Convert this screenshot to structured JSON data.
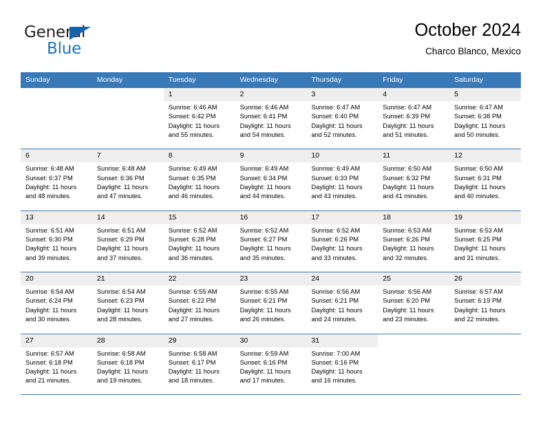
{
  "brand": {
    "name_part1": "General",
    "name_part2": "Blue",
    "accent_color": "#1b75bb",
    "triangle_color": "#1464ad"
  },
  "header": {
    "title": "October 2024",
    "subtitle": "Charco Blanco, Mexico"
  },
  "calendar": {
    "header_bg": "#3a79b8",
    "daynum_band_bg": "#eeeeee",
    "weekdays": [
      "Sunday",
      "Monday",
      "Tuesday",
      "Wednesday",
      "Thursday",
      "Friday",
      "Saturday"
    ],
    "weeks": [
      [
        {
          "day": "",
          "sunrise": "",
          "sunset": "",
          "daylight1": "",
          "daylight2": "",
          "blank": true
        },
        {
          "day": "",
          "sunrise": "",
          "sunset": "",
          "daylight1": "",
          "daylight2": "",
          "blank": true
        },
        {
          "day": "1",
          "sunrise": "Sunrise: 6:46 AM",
          "sunset": "Sunset: 6:42 PM",
          "daylight1": "Daylight: 11 hours",
          "daylight2": "and 55 minutes."
        },
        {
          "day": "2",
          "sunrise": "Sunrise: 6:46 AM",
          "sunset": "Sunset: 6:41 PM",
          "daylight1": "Daylight: 11 hours",
          "daylight2": "and 54 minutes."
        },
        {
          "day": "3",
          "sunrise": "Sunrise: 6:47 AM",
          "sunset": "Sunset: 6:40 PM",
          "daylight1": "Daylight: 11 hours",
          "daylight2": "and 52 minutes."
        },
        {
          "day": "4",
          "sunrise": "Sunrise: 6:47 AM",
          "sunset": "Sunset: 6:39 PM",
          "daylight1": "Daylight: 11 hours",
          "daylight2": "and 51 minutes."
        },
        {
          "day": "5",
          "sunrise": "Sunrise: 6:47 AM",
          "sunset": "Sunset: 6:38 PM",
          "daylight1": "Daylight: 11 hours",
          "daylight2": "and 50 minutes."
        }
      ],
      [
        {
          "day": "6",
          "sunrise": "Sunrise: 6:48 AM",
          "sunset": "Sunset: 6:37 PM",
          "daylight1": "Daylight: 11 hours",
          "daylight2": "and 48 minutes."
        },
        {
          "day": "7",
          "sunrise": "Sunrise: 6:48 AM",
          "sunset": "Sunset: 6:36 PM",
          "daylight1": "Daylight: 11 hours",
          "daylight2": "and 47 minutes."
        },
        {
          "day": "8",
          "sunrise": "Sunrise: 6:49 AM",
          "sunset": "Sunset: 6:35 PM",
          "daylight1": "Daylight: 11 hours",
          "daylight2": "and 46 minutes."
        },
        {
          "day": "9",
          "sunrise": "Sunrise: 6:49 AM",
          "sunset": "Sunset: 6:34 PM",
          "daylight1": "Daylight: 11 hours",
          "daylight2": "and 44 minutes."
        },
        {
          "day": "10",
          "sunrise": "Sunrise: 6:49 AM",
          "sunset": "Sunset: 6:33 PM",
          "daylight1": "Daylight: 11 hours",
          "daylight2": "and 43 minutes."
        },
        {
          "day": "11",
          "sunrise": "Sunrise: 6:50 AM",
          "sunset": "Sunset: 6:32 PM",
          "daylight1": "Daylight: 11 hours",
          "daylight2": "and 41 minutes."
        },
        {
          "day": "12",
          "sunrise": "Sunrise: 6:50 AM",
          "sunset": "Sunset: 6:31 PM",
          "daylight1": "Daylight: 11 hours",
          "daylight2": "and 40 minutes."
        }
      ],
      [
        {
          "day": "13",
          "sunrise": "Sunrise: 6:51 AM",
          "sunset": "Sunset: 6:30 PM",
          "daylight1": "Daylight: 11 hours",
          "daylight2": "and 39 minutes."
        },
        {
          "day": "14",
          "sunrise": "Sunrise: 6:51 AM",
          "sunset": "Sunset: 6:29 PM",
          "daylight1": "Daylight: 11 hours",
          "daylight2": "and 37 minutes."
        },
        {
          "day": "15",
          "sunrise": "Sunrise: 6:52 AM",
          "sunset": "Sunset: 6:28 PM",
          "daylight1": "Daylight: 11 hours",
          "daylight2": "and 36 minutes."
        },
        {
          "day": "16",
          "sunrise": "Sunrise: 6:52 AM",
          "sunset": "Sunset: 6:27 PM",
          "daylight1": "Daylight: 11 hours",
          "daylight2": "and 35 minutes."
        },
        {
          "day": "17",
          "sunrise": "Sunrise: 6:52 AM",
          "sunset": "Sunset: 6:26 PM",
          "daylight1": "Daylight: 11 hours",
          "daylight2": "and 33 minutes."
        },
        {
          "day": "18",
          "sunrise": "Sunrise: 6:53 AM",
          "sunset": "Sunset: 6:26 PM",
          "daylight1": "Daylight: 11 hours",
          "daylight2": "and 32 minutes."
        },
        {
          "day": "19",
          "sunrise": "Sunrise: 6:53 AM",
          "sunset": "Sunset: 6:25 PM",
          "daylight1": "Daylight: 11 hours",
          "daylight2": "and 31 minutes."
        }
      ],
      [
        {
          "day": "20",
          "sunrise": "Sunrise: 6:54 AM",
          "sunset": "Sunset: 6:24 PM",
          "daylight1": "Daylight: 11 hours",
          "daylight2": "and 30 minutes."
        },
        {
          "day": "21",
          "sunrise": "Sunrise: 6:54 AM",
          "sunset": "Sunset: 6:23 PM",
          "daylight1": "Daylight: 11 hours",
          "daylight2": "and 28 minutes."
        },
        {
          "day": "22",
          "sunrise": "Sunrise: 6:55 AM",
          "sunset": "Sunset: 6:22 PM",
          "daylight1": "Daylight: 11 hours",
          "daylight2": "and 27 minutes."
        },
        {
          "day": "23",
          "sunrise": "Sunrise: 6:55 AM",
          "sunset": "Sunset: 6:21 PM",
          "daylight1": "Daylight: 11 hours",
          "daylight2": "and 26 minutes."
        },
        {
          "day": "24",
          "sunrise": "Sunrise: 6:56 AM",
          "sunset": "Sunset: 6:21 PM",
          "daylight1": "Daylight: 11 hours",
          "daylight2": "and 24 minutes."
        },
        {
          "day": "25",
          "sunrise": "Sunrise: 6:56 AM",
          "sunset": "Sunset: 6:20 PM",
          "daylight1": "Daylight: 11 hours",
          "daylight2": "and 23 minutes."
        },
        {
          "day": "26",
          "sunrise": "Sunrise: 6:57 AM",
          "sunset": "Sunset: 6:19 PM",
          "daylight1": "Daylight: 11 hours",
          "daylight2": "and 22 minutes."
        }
      ],
      [
        {
          "day": "27",
          "sunrise": "Sunrise: 6:57 AM",
          "sunset": "Sunset: 6:18 PM",
          "daylight1": "Daylight: 11 hours",
          "daylight2": "and 21 minutes."
        },
        {
          "day": "28",
          "sunrise": "Sunrise: 6:58 AM",
          "sunset": "Sunset: 6:18 PM",
          "daylight1": "Daylight: 11 hours",
          "daylight2": "and 19 minutes."
        },
        {
          "day": "29",
          "sunrise": "Sunrise: 6:58 AM",
          "sunset": "Sunset: 6:17 PM",
          "daylight1": "Daylight: 11 hours",
          "daylight2": "and 18 minutes."
        },
        {
          "day": "30",
          "sunrise": "Sunrise: 6:59 AM",
          "sunset": "Sunset: 6:16 PM",
          "daylight1": "Daylight: 11 hours",
          "daylight2": "and 17 minutes."
        },
        {
          "day": "31",
          "sunrise": "Sunrise: 7:00 AM",
          "sunset": "Sunset: 6:16 PM",
          "daylight1": "Daylight: 11 hours",
          "daylight2": "and 16 minutes."
        },
        {
          "day": "",
          "sunrise": "",
          "sunset": "",
          "daylight1": "",
          "daylight2": "",
          "blank": true
        },
        {
          "day": "",
          "sunrise": "",
          "sunset": "",
          "daylight1": "",
          "daylight2": "",
          "blank": true
        }
      ]
    ]
  }
}
